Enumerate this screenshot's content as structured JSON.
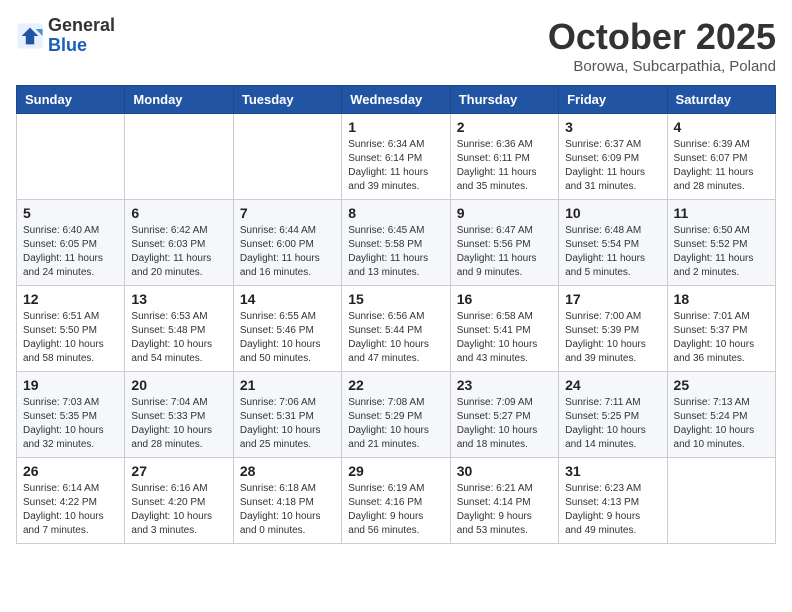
{
  "header": {
    "logo_general": "General",
    "logo_blue": "Blue",
    "month": "October 2025",
    "location": "Borowa, Subcarpathia, Poland"
  },
  "weekdays": [
    "Sunday",
    "Monday",
    "Tuesday",
    "Wednesday",
    "Thursday",
    "Friday",
    "Saturday"
  ],
  "weeks": [
    [
      {
        "day": "",
        "info": ""
      },
      {
        "day": "",
        "info": ""
      },
      {
        "day": "",
        "info": ""
      },
      {
        "day": "1",
        "info": "Sunrise: 6:34 AM\nSunset: 6:14 PM\nDaylight: 11 hours\nand 39 minutes."
      },
      {
        "day": "2",
        "info": "Sunrise: 6:36 AM\nSunset: 6:11 PM\nDaylight: 11 hours\nand 35 minutes."
      },
      {
        "day": "3",
        "info": "Sunrise: 6:37 AM\nSunset: 6:09 PM\nDaylight: 11 hours\nand 31 minutes."
      },
      {
        "day": "4",
        "info": "Sunrise: 6:39 AM\nSunset: 6:07 PM\nDaylight: 11 hours\nand 28 minutes."
      }
    ],
    [
      {
        "day": "5",
        "info": "Sunrise: 6:40 AM\nSunset: 6:05 PM\nDaylight: 11 hours\nand 24 minutes."
      },
      {
        "day": "6",
        "info": "Sunrise: 6:42 AM\nSunset: 6:03 PM\nDaylight: 11 hours\nand 20 minutes."
      },
      {
        "day": "7",
        "info": "Sunrise: 6:44 AM\nSunset: 6:00 PM\nDaylight: 11 hours\nand 16 minutes."
      },
      {
        "day": "8",
        "info": "Sunrise: 6:45 AM\nSunset: 5:58 PM\nDaylight: 11 hours\nand 13 minutes."
      },
      {
        "day": "9",
        "info": "Sunrise: 6:47 AM\nSunset: 5:56 PM\nDaylight: 11 hours\nand 9 minutes."
      },
      {
        "day": "10",
        "info": "Sunrise: 6:48 AM\nSunset: 5:54 PM\nDaylight: 11 hours\nand 5 minutes."
      },
      {
        "day": "11",
        "info": "Sunrise: 6:50 AM\nSunset: 5:52 PM\nDaylight: 11 hours\nand 2 minutes."
      }
    ],
    [
      {
        "day": "12",
        "info": "Sunrise: 6:51 AM\nSunset: 5:50 PM\nDaylight: 10 hours\nand 58 minutes."
      },
      {
        "day": "13",
        "info": "Sunrise: 6:53 AM\nSunset: 5:48 PM\nDaylight: 10 hours\nand 54 minutes."
      },
      {
        "day": "14",
        "info": "Sunrise: 6:55 AM\nSunset: 5:46 PM\nDaylight: 10 hours\nand 50 minutes."
      },
      {
        "day": "15",
        "info": "Sunrise: 6:56 AM\nSunset: 5:44 PM\nDaylight: 10 hours\nand 47 minutes."
      },
      {
        "day": "16",
        "info": "Sunrise: 6:58 AM\nSunset: 5:41 PM\nDaylight: 10 hours\nand 43 minutes."
      },
      {
        "day": "17",
        "info": "Sunrise: 7:00 AM\nSunset: 5:39 PM\nDaylight: 10 hours\nand 39 minutes."
      },
      {
        "day": "18",
        "info": "Sunrise: 7:01 AM\nSunset: 5:37 PM\nDaylight: 10 hours\nand 36 minutes."
      }
    ],
    [
      {
        "day": "19",
        "info": "Sunrise: 7:03 AM\nSunset: 5:35 PM\nDaylight: 10 hours\nand 32 minutes."
      },
      {
        "day": "20",
        "info": "Sunrise: 7:04 AM\nSunset: 5:33 PM\nDaylight: 10 hours\nand 28 minutes."
      },
      {
        "day": "21",
        "info": "Sunrise: 7:06 AM\nSunset: 5:31 PM\nDaylight: 10 hours\nand 25 minutes."
      },
      {
        "day": "22",
        "info": "Sunrise: 7:08 AM\nSunset: 5:29 PM\nDaylight: 10 hours\nand 21 minutes."
      },
      {
        "day": "23",
        "info": "Sunrise: 7:09 AM\nSunset: 5:27 PM\nDaylight: 10 hours\nand 18 minutes."
      },
      {
        "day": "24",
        "info": "Sunrise: 7:11 AM\nSunset: 5:25 PM\nDaylight: 10 hours\nand 14 minutes."
      },
      {
        "day": "25",
        "info": "Sunrise: 7:13 AM\nSunset: 5:24 PM\nDaylight: 10 hours\nand 10 minutes."
      }
    ],
    [
      {
        "day": "26",
        "info": "Sunrise: 6:14 AM\nSunset: 4:22 PM\nDaylight: 10 hours\nand 7 minutes."
      },
      {
        "day": "27",
        "info": "Sunrise: 6:16 AM\nSunset: 4:20 PM\nDaylight: 10 hours\nand 3 minutes."
      },
      {
        "day": "28",
        "info": "Sunrise: 6:18 AM\nSunset: 4:18 PM\nDaylight: 10 hours\nand 0 minutes."
      },
      {
        "day": "29",
        "info": "Sunrise: 6:19 AM\nSunset: 4:16 PM\nDaylight: 9 hours\nand 56 minutes."
      },
      {
        "day": "30",
        "info": "Sunrise: 6:21 AM\nSunset: 4:14 PM\nDaylight: 9 hours\nand 53 minutes."
      },
      {
        "day": "31",
        "info": "Sunrise: 6:23 AM\nSunset: 4:13 PM\nDaylight: 9 hours\nand 49 minutes."
      },
      {
        "day": "",
        "info": ""
      }
    ]
  ]
}
